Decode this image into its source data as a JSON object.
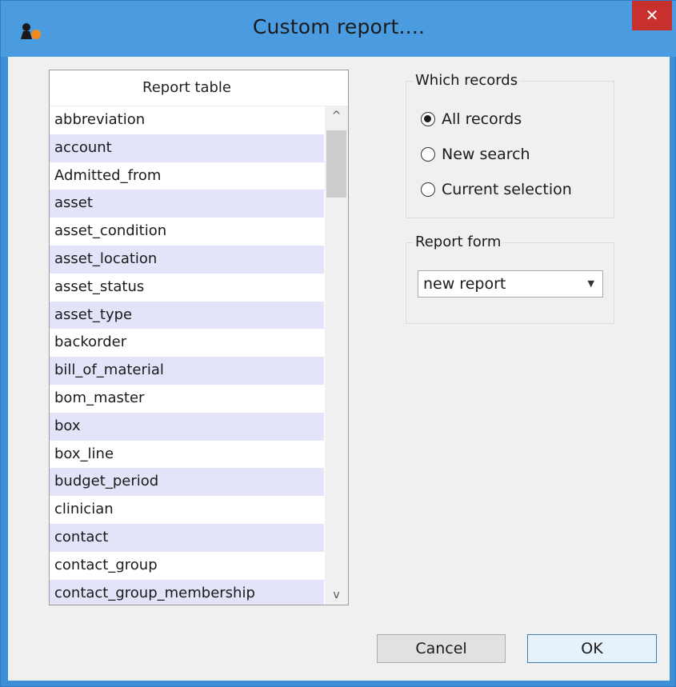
{
  "window": {
    "title": "Custom report....",
    "close_glyph": "✕",
    "app_icon": "mSupply-app-icon"
  },
  "report_table": {
    "header": "Report table",
    "items": [
      "abbreviation",
      "account",
      "Admitted_from",
      "asset",
      "asset_condition",
      "asset_location",
      "asset_status",
      "asset_type",
      "backorder",
      "bill_of_material",
      "bom_master",
      "box",
      "box_line",
      "budget_period",
      "clinician",
      "contact",
      "contact_group",
      "contact_group_membership"
    ],
    "scroll_up_glyph": "^",
    "scroll_down_glyph": "v"
  },
  "which_records": {
    "label": "Which records",
    "options": [
      {
        "label": "All records",
        "selected": true
      },
      {
        "label": "New search",
        "selected": false
      },
      {
        "label": "Current selection",
        "selected": false
      }
    ]
  },
  "report_form": {
    "label": "Report form",
    "selected": "new report",
    "arrow_glyph": "▼"
  },
  "buttons": {
    "cancel": "Cancel",
    "ok": "OK"
  },
  "colors": {
    "titlebar": "#4a9be0",
    "close": "#c7302c",
    "alt_row": "#e3e3fa"
  }
}
